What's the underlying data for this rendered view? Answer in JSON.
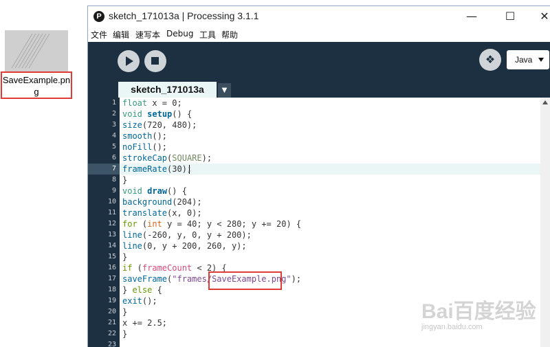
{
  "desktop": {
    "file_label": "SaveExample.png"
  },
  "window": {
    "title": "sketch_171013a | Processing 3.1.1",
    "app_icon_glyph": "P",
    "controls": {
      "minimize": "—",
      "maximize": "☐",
      "close": "✕"
    }
  },
  "menubar": {
    "items": [
      "文件",
      "编辑",
      "速写本",
      "Debug",
      "工具",
      "帮助"
    ]
  },
  "toolbar": {
    "run_icon": "play-icon",
    "stop_icon": "stop-icon",
    "debug_glyph": "❖",
    "mode_label": "Java"
  },
  "tabs": {
    "active": "sketch_171013a",
    "menu_glyph": "▼"
  },
  "editor": {
    "active_line": 7,
    "lines": [
      {
        "num": "1",
        "segs": [
          {
            "t": "float",
            "c": "#33997e"
          },
          {
            "t": " x = 0;",
            "c": "#333333"
          }
        ]
      },
      {
        "num": "2",
        "segs": [
          {
            "t": "void",
            "c": "#33997e"
          },
          {
            "t": " ",
            "c": "#333333"
          },
          {
            "t": "setup",
            "c": "#006699",
            "b": true
          },
          {
            "t": "() {",
            "c": "#333333"
          }
        ]
      },
      {
        "num": "3",
        "segs": [
          {
            "t": "size",
            "c": "#006699"
          },
          {
            "t": "(720, 480);",
            "c": "#333333"
          }
        ]
      },
      {
        "num": "4",
        "segs": [
          {
            "t": "smooth",
            "c": "#006699"
          },
          {
            "t": "();",
            "c": "#333333"
          }
        ]
      },
      {
        "num": "5",
        "segs": [
          {
            "t": "noFill",
            "c": "#006699"
          },
          {
            "t": "();",
            "c": "#333333"
          }
        ]
      },
      {
        "num": "6",
        "segs": [
          {
            "t": "strokeCap",
            "c": "#006699"
          },
          {
            "t": "(",
            "c": "#333333"
          },
          {
            "t": "SQUARE",
            "c": "#718a62"
          },
          {
            "t": ");",
            "c": "#333333"
          }
        ]
      },
      {
        "num": "7",
        "segs": [
          {
            "t": "frameRate",
            "c": "#006699"
          },
          {
            "t": "(30);",
            "c": "#333333"
          }
        ]
      },
      {
        "num": "8",
        "segs": [
          {
            "t": "}",
            "c": "#333333"
          }
        ]
      },
      {
        "num": "9",
        "segs": [
          {
            "t": "void",
            "c": "#33997e"
          },
          {
            "t": " ",
            "c": "#333333"
          },
          {
            "t": "draw",
            "c": "#006699",
            "b": true
          },
          {
            "t": "() {",
            "c": "#333333"
          }
        ]
      },
      {
        "num": "10",
        "segs": [
          {
            "t": "background",
            "c": "#006699"
          },
          {
            "t": "(204);",
            "c": "#333333"
          }
        ]
      },
      {
        "num": "11",
        "segs": [
          {
            "t": "translate",
            "c": "#006699"
          },
          {
            "t": "(x, 0);",
            "c": "#333333"
          }
        ]
      },
      {
        "num": "12",
        "segs": [
          {
            "t": "for",
            "c": "#669900"
          },
          {
            "t": " (",
            "c": "#333333"
          },
          {
            "t": "int",
            "c": "#e2661a"
          },
          {
            "t": " y = 40; y < 280; y += 20) {",
            "c": "#333333"
          }
        ]
      },
      {
        "num": "13",
        "segs": [
          {
            "t": "line",
            "c": "#006699"
          },
          {
            "t": "(-260, y, 0, y + 200);",
            "c": "#333333"
          }
        ]
      },
      {
        "num": "14",
        "segs": [
          {
            "t": "line",
            "c": "#006699"
          },
          {
            "t": "(0, y + 200, 260, y);",
            "c": "#333333"
          }
        ]
      },
      {
        "num": "15",
        "segs": [
          {
            "t": "}",
            "c": "#333333"
          }
        ]
      },
      {
        "num": "16",
        "segs": [
          {
            "t": "if",
            "c": "#669900"
          },
          {
            "t": " (",
            "c": "#333333"
          },
          {
            "t": "frameCount",
            "c": "#d94a7a"
          },
          {
            "t": " < 2) {",
            "c": "#333333"
          }
        ]
      },
      {
        "num": "17",
        "segs": [
          {
            "t": "saveFrame",
            "c": "#006699"
          },
          {
            "t": "(",
            "c": "#333333"
          },
          {
            "t": "\"frames/SaveExample.png\"",
            "c": "#7d4793"
          },
          {
            "t": ");",
            "c": "#333333"
          }
        ]
      },
      {
        "num": "18",
        "segs": [
          {
            "t": "} ",
            "c": "#333333"
          },
          {
            "t": "else",
            "c": "#669900"
          },
          {
            "t": " {",
            "c": "#333333"
          }
        ]
      },
      {
        "num": "19",
        "segs": [
          {
            "t": "exit",
            "c": "#006699"
          },
          {
            "t": "();",
            "c": "#333333"
          }
        ]
      },
      {
        "num": "20",
        "segs": [
          {
            "t": "}",
            "c": "#333333"
          }
        ]
      },
      {
        "num": "21",
        "segs": [
          {
            "t": "x += 2.5;",
            "c": "#333333"
          }
        ]
      },
      {
        "num": "22",
        "segs": [
          {
            "t": "}",
            "c": "#333333"
          }
        ]
      },
      {
        "num": "23",
        "segs": [
          {
            "t": "",
            "c": "#333333"
          }
        ]
      }
    ]
  },
  "watermark": {
    "logo": "Bai百度经验",
    "url": "jingyan.baidu.com"
  },
  "colors": {
    "toolbar_bg": "#1d3041",
    "active_tab_bg": "#eaf5f5",
    "annotation_red": "#e03a35"
  }
}
